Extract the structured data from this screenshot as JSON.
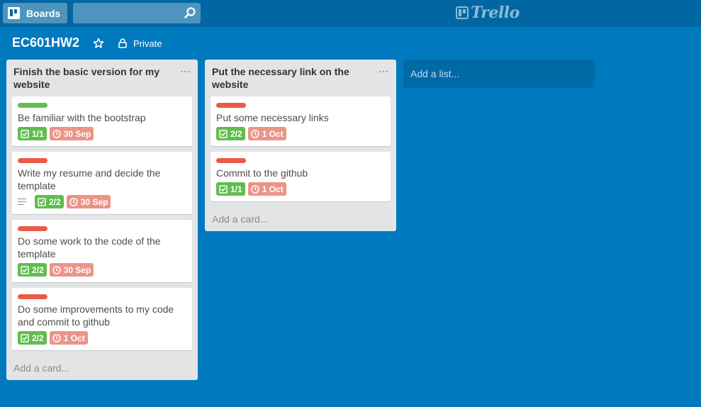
{
  "header": {
    "boards_label": "Boards",
    "search_placeholder": "",
    "logo_text": "Trello"
  },
  "board": {
    "title": "EC601HW2",
    "visibility": "Private"
  },
  "colors": {
    "background": "#0079bf",
    "label_green": "#61bd4f",
    "label_red": "#eb5a46",
    "badge_due": "#ec9488"
  },
  "lists": [
    {
      "title": "Finish the basic version for my website",
      "menu": "...",
      "add_card": "Add a card...",
      "cards": [
        {
          "label_color": "green",
          "title": "Be familiar with the bootstrap",
          "has_description": false,
          "checklist": "1/1",
          "due": "30 Sep"
        },
        {
          "label_color": "red",
          "title": "Write my resume and decide the template",
          "has_description": true,
          "checklist": "2/2",
          "due": "30 Sep"
        },
        {
          "label_color": "red",
          "title": "Do some work to the code of the template",
          "has_description": false,
          "checklist": "2/2",
          "due": "30 Sep"
        },
        {
          "label_color": "red",
          "title": "Do some improvements to my code and commit to github",
          "has_description": false,
          "checklist": "2/2",
          "due": "1 Oct"
        }
      ]
    },
    {
      "title": "Put the necessary link on the website",
      "menu": "...",
      "add_card": "Add a card...",
      "cards": [
        {
          "label_color": "red",
          "title": "Put some necessary links",
          "has_description": false,
          "checklist": "2/2",
          "due": "1 Oct"
        },
        {
          "label_color": "red",
          "title": "Commit to the github",
          "has_description": false,
          "checklist": "1/1",
          "due": "1 Oct"
        }
      ]
    }
  ],
  "add_list": "Add a list..."
}
